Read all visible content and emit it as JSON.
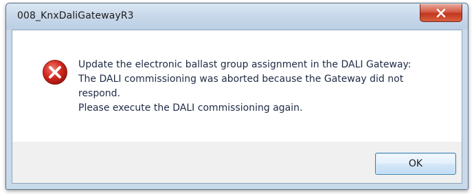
{
  "window": {
    "title": "008_KnxDaliGatewayR3"
  },
  "message": {
    "lines": [
      "Update the electronic ballast group assignment in the DALI Gateway:",
      "The DALI commissioning was aborted because the Gateway did not",
      "respond.",
      "Please execute the DALI commissioning again."
    ]
  },
  "buttons": {
    "ok_label": "OK"
  },
  "icons": {
    "status": "error-icon",
    "close": "close-icon"
  },
  "colors": {
    "error_red": "#c8201a",
    "close_button_red": "#c1371f"
  }
}
